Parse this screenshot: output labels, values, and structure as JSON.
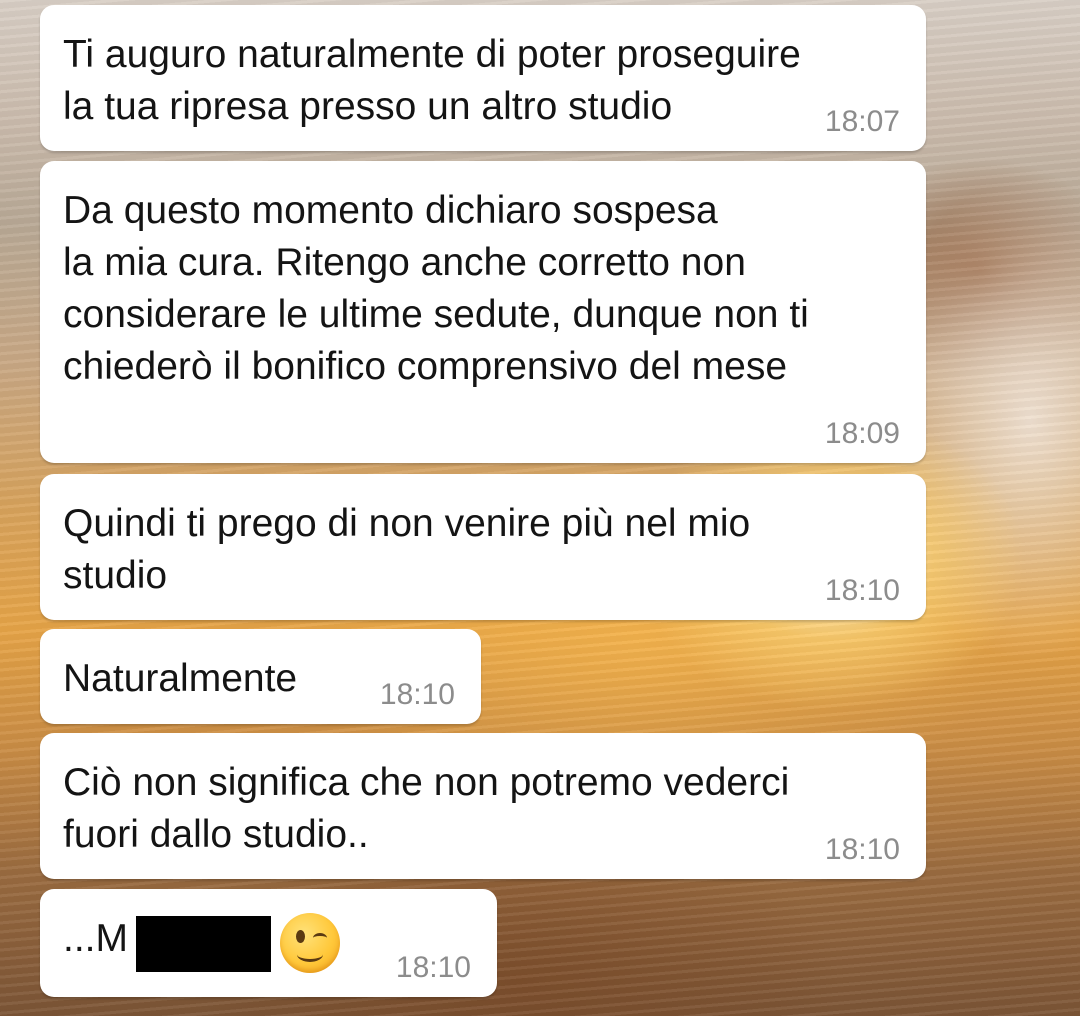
{
  "messages": [
    {
      "text": "Ti auguro naturalmente di poter proseguire\nla tua ripresa presso un altro studio",
      "time": "18:07"
    },
    {
      "text": "Da questo momento dichiaro sospesa\nla mia cura. Ritengo anche corretto non\nconsiderare le ultime sedute, dunque non ti\nchiederò il bonifico comprensivo del mese",
      "time": "18:09"
    },
    {
      "text": "Quindi ti prego di non venire più nel mio\nstudio",
      "time": "18:10"
    },
    {
      "text": "Naturalmente",
      "time": "18:10"
    },
    {
      "text": "Ciò non significa che non potremo vederci\nfuori dallo studio..",
      "time": "18:10"
    },
    {
      "text": "...M",
      "time": "18:10",
      "emoji": "winking-face-icon"
    }
  ]
}
